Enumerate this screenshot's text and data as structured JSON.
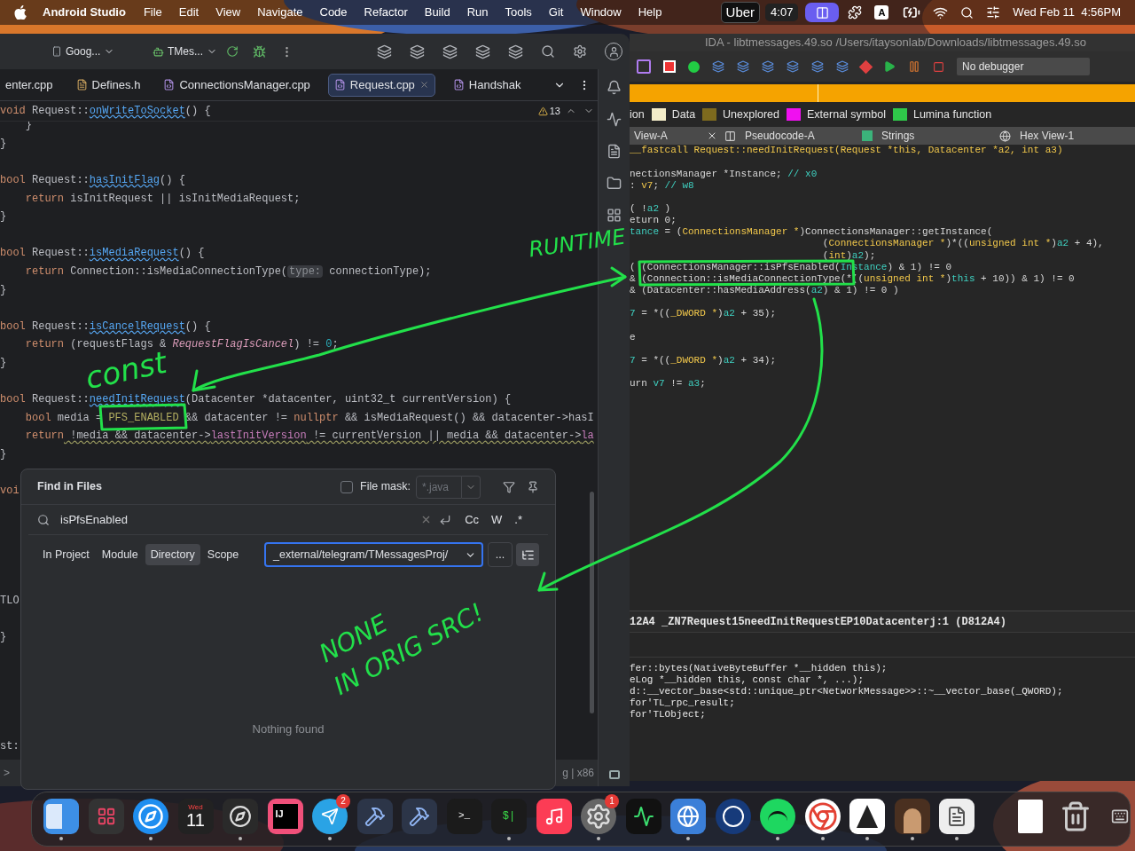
{
  "menu_bar": {
    "app": "Android Studio",
    "items": [
      "File",
      "Edit",
      "View",
      "Navigate",
      "Code",
      "Refactor",
      "Build",
      "Run",
      "Tools",
      "Git",
      "Window",
      "Help"
    ],
    "uber": "Uber",
    "timer": "4:07",
    "input_source": "A",
    "datetime": "Wed Feb 11  4:56PM"
  },
  "android_studio": {
    "device": "Goog...",
    "config": "TMes...",
    "tabs": [
      {
        "label": "enter.cpp",
        "kind": "plain",
        "selected": false
      },
      {
        "label": "Defines.h",
        "kind": "header",
        "selected": false
      },
      {
        "label": "ConnectionsManager.cpp",
        "kind": "cpp",
        "selected": false
      },
      {
        "label": "Request.cpp",
        "kind": "cpp",
        "selected": true
      },
      {
        "label": "Handshak",
        "kind": "cpp",
        "selected": false
      }
    ],
    "warning_count": "13",
    "sticky_line": [
      {
        "text": "void",
        "kind": "keyword"
      },
      {
        "text": " Request::",
        "kind": "plain"
      },
      {
        "text": "onWriteToSocket",
        "kind": "function"
      },
      {
        "text": "() {",
        "kind": "plain"
      }
    ],
    "code_lines": [
      {
        "kind": "code",
        "tokens": [
          {
            "text": "    }",
            "kind": "plain"
          }
        ]
      },
      {
        "kind": "code",
        "tokens": [
          {
            "text": "}",
            "kind": "plain"
          }
        ]
      },
      {
        "kind": "blank"
      },
      {
        "kind": "code",
        "tokens": [
          {
            "text": "bool",
            "kind": "keyword"
          },
          {
            "text": " Request::",
            "kind": "plain"
          },
          {
            "text": "hasInitFlag",
            "kind": "function"
          },
          {
            "text": "() {",
            "kind": "plain"
          }
        ]
      },
      {
        "kind": "code",
        "tokens": [
          {
            "text": "    return",
            "kind": "keyword"
          },
          {
            "text": " isInitRequest || isInitMediaRequest;",
            "kind": "plain"
          }
        ]
      },
      {
        "kind": "code",
        "tokens": [
          {
            "text": "}",
            "kind": "plain"
          }
        ]
      },
      {
        "kind": "blank"
      },
      {
        "kind": "code",
        "tokens": [
          {
            "text": "bool",
            "kind": "keyword"
          },
          {
            "text": " Request::",
            "kind": "plain"
          },
          {
            "text": "isMediaRequest",
            "kind": "function"
          },
          {
            "text": "() {",
            "kind": "plain"
          }
        ]
      },
      {
        "kind": "code",
        "tokens": [
          {
            "text": "    return",
            "kind": "keyword"
          },
          {
            "text": " Connection::isMediaConnectionType(",
            "kind": "plain"
          },
          {
            "text": "type:",
            "kind": "hint"
          },
          {
            "text": " connectionType);",
            "kind": "plain"
          }
        ]
      },
      {
        "kind": "code",
        "tokens": [
          {
            "text": "}",
            "kind": "plain"
          }
        ]
      },
      {
        "kind": "blank"
      },
      {
        "kind": "code",
        "tokens": [
          {
            "text": "bool",
            "kind": "keyword"
          },
          {
            "text": " Request::",
            "kind": "plain"
          },
          {
            "text": "isCancelRequest",
            "kind": "function"
          },
          {
            "text": "() {",
            "kind": "plain"
          }
        ]
      },
      {
        "kind": "code",
        "tokens": [
          {
            "text": "    return",
            "kind": "keyword"
          },
          {
            "text": " (requestFlags & ",
            "kind": "plain"
          },
          {
            "text": "RequestFlagIsCancel",
            "kind": "constant"
          },
          {
            "text": ") != ",
            "kind": "plain"
          },
          {
            "text": "0",
            "kind": "number"
          },
          {
            "text": ";",
            "kind": "plain"
          }
        ]
      },
      {
        "kind": "code",
        "tokens": [
          {
            "text": "}",
            "kind": "plain"
          }
        ]
      },
      {
        "kind": "blank"
      },
      {
        "kind": "code",
        "tokens": [
          {
            "text": "bool",
            "kind": "keyword"
          },
          {
            "text": " Request::",
            "kind": "plain"
          },
          {
            "text": "needInitRequest",
            "kind": "function"
          },
          {
            "text": "(Datacenter *datacenter, uint32_t currentVersion) {",
            "kind": "plain"
          }
        ]
      },
      {
        "kind": "code",
        "tokens": [
          {
            "text": "    bool",
            "kind": "keyword"
          },
          {
            "text": " media = ",
            "kind": "plain"
          },
          {
            "text": "PFS_ENABLED",
            "kind": "macro"
          },
          {
            "text": " && datacenter != ",
            "kind": "plain"
          },
          {
            "text": "nullptr",
            "kind": "keyword"
          },
          {
            "text": " && isMediaRequest() && datacenter->hasI",
            "kind": "plain"
          }
        ]
      },
      {
        "kind": "code",
        "tokens": [
          {
            "text": "    return",
            "kind": "keyword"
          },
          {
            "text": " !media && datacenter->",
            "kind": "warn"
          },
          {
            "text": "lastInitVersion",
            "kind": "field"
          },
          {
            "text": " != currentVersion || media && datacenter->",
            "kind": "warn"
          },
          {
            "text": "la",
            "kind": "field"
          }
        ]
      },
      {
        "kind": "code",
        "tokens": [
          {
            "text": "}",
            "kind": "plain"
          }
        ]
      },
      {
        "kind": "blank"
      },
      {
        "kind": "code",
        "tokens": [
          {
            "text": "voi",
            "kind": "keyword"
          }
        ]
      },
      {
        "kind": "blank"
      },
      {
        "kind": "blank"
      },
      {
        "kind": "blank"
      },
      {
        "kind": "blank"
      },
      {
        "kind": "blank"
      },
      {
        "kind": "code",
        "tokens": [
          {
            "text": "TLO",
            "kind": "plain"
          }
        ]
      },
      {
        "kind": "blank"
      },
      {
        "kind": "code",
        "tokens": [
          {
            "text": "}",
            "kind": "plain"
          }
        ]
      },
      {
        "kind": "blank"
      },
      {
        "kind": "blank"
      },
      {
        "kind": "blank"
      },
      {
        "kind": "blank"
      },
      {
        "kind": "blank"
      },
      {
        "kind": "code",
        "tokens": [
          {
            "text": "st:",
            "kind": "plain"
          }
        ]
      }
    ],
    "status_left": ">",
    "status_right": "g | x86"
  },
  "find_in_files": {
    "title": "Find in Files",
    "file_mask": {
      "label": "File mask:",
      "checked": false,
      "placeholder": "*.java"
    },
    "query": "isPfsEnabled",
    "options": [
      {
        "label": "Cc",
        "selected": false
      },
      {
        "label": "W",
        "selected": false
      },
      {
        "label": ".*",
        "selected": false
      }
    ],
    "scopes": [
      {
        "label": "In Project",
        "selected": false
      },
      {
        "label": "Module",
        "selected": false
      },
      {
        "label": "Directory",
        "selected": true
      },
      {
        "label": "Scope",
        "selected": false
      }
    ],
    "directory": "_external/telegram/TMessagesProj/",
    "browse": "...",
    "result": "Nothing found"
  },
  "ida": {
    "title": "IDA - libtmessages.49.so /Users/itaysonlab/Downloads/libtmessages.49.so",
    "debugger": "No debugger",
    "legend": [
      {
        "label": "ion"
      },
      {
        "label": "Data",
        "color": "#f3ecc8"
      },
      {
        "label": "Unexplored",
        "color": "#7d6a1e"
      },
      {
        "label": "External symbol",
        "color": "#f010f0"
      },
      {
        "label": "Lumina function",
        "color": "#2fc84a"
      }
    ],
    "tabs": [
      {
        "label": "View-A",
        "kind": "view",
        "selected": false
      },
      {
        "label": "Pseudocode-A",
        "kind": "pseudocode",
        "selected": false
      },
      {
        "label": "Strings",
        "kind": "strings",
        "selected": false
      },
      {
        "label": "Hex View-1",
        "kind": "hex",
        "selected": false
      }
    ],
    "pseudocode": [
      {
        "kind": "code",
        "tokens": [
          {
            "text": "__fastcall Request::needInitRequest(Request *this, Datacenter *a2, int a3)",
            "kind": "type"
          }
        ]
      },
      {
        "kind": "blank"
      },
      {
        "kind": "code",
        "tokens": [
          {
            "text": "nectionsManager *Instance; ",
            "kind": "plain"
          },
          {
            "text": "// x0",
            "kind": "comment"
          }
        ]
      },
      {
        "kind": "code",
        "tokens": [
          {
            "text": ": ",
            "kind": "plain"
          },
          {
            "text": "v7",
            "kind": "type"
          },
          {
            "text": "; ",
            "kind": "plain"
          },
          {
            "text": "// w8",
            "kind": "comment"
          }
        ]
      },
      {
        "kind": "blank"
      },
      {
        "kind": "code",
        "tokens": [
          {
            "text": "( !",
            "kind": "plain"
          },
          {
            "text": "a2",
            "kind": "var"
          },
          {
            "text": " )",
            "kind": "plain"
          }
        ]
      },
      {
        "kind": "code",
        "tokens": [
          {
            "text": "eturn 0;",
            "kind": "plain"
          }
        ]
      },
      {
        "kind": "code",
        "tokens": [
          {
            "text": "tance",
            "kind": "var"
          },
          {
            "text": " = (",
            "kind": "plain"
          },
          {
            "text": "ConnectionsManager *",
            "kind": "type"
          },
          {
            "text": ")ConnectionsManager::getInstance(",
            "kind": "plain"
          }
        ]
      },
      {
        "kind": "code",
        "tokens": [
          {
            "text": "                                 (",
            "kind": "plain"
          },
          {
            "text": "ConnectionsManager *",
            "kind": "type"
          },
          {
            "text": ")*((",
            "kind": "plain"
          },
          {
            "text": "unsigned int *",
            "kind": "type"
          },
          {
            "text": ")",
            "kind": "plain"
          },
          {
            "text": "a2",
            "kind": "var"
          },
          {
            "text": " + 4),",
            "kind": "plain"
          }
        ]
      },
      {
        "kind": "code",
        "tokens": [
          {
            "text": "                                 (",
            "kind": "plain"
          },
          {
            "text": "int",
            "kind": "type"
          },
          {
            "text": ")",
            "kind": "plain"
          },
          {
            "text": "a2",
            "kind": "var"
          },
          {
            "text": ");",
            "kind": "plain"
          }
        ]
      },
      {
        "kind": "code",
        "tokens": [
          {
            "text": "( (ConnectionsManager::isPfsEnabled(",
            "kind": "plain"
          },
          {
            "text": "Instance",
            "kind": "var"
          },
          {
            "text": ") & 1) != 0",
            "kind": "plain"
          }
        ]
      },
      {
        "kind": "code",
        "tokens": [
          {
            "text": "& (Connection::isMediaConnectionType(*((",
            "kind": "plain"
          },
          {
            "text": "unsigned int *",
            "kind": "type"
          },
          {
            "text": ")",
            "kind": "plain"
          },
          {
            "text": "this",
            "kind": "var"
          },
          {
            "text": " + 10)) & 1) != 0",
            "kind": "plain"
          }
        ]
      },
      {
        "kind": "code",
        "tokens": [
          {
            "text": "& (Datacenter::hasMediaAddress(",
            "kind": "plain"
          },
          {
            "text": "a2",
            "kind": "var"
          },
          {
            "text": ") & 1) != 0 )",
            "kind": "plain"
          }
        ]
      },
      {
        "kind": "blank"
      },
      {
        "kind": "code",
        "tokens": [
          {
            "text": "7",
            "kind": "var"
          },
          {
            "text": " = *((",
            "kind": "plain"
          },
          {
            "text": "_DWORD *",
            "kind": "type"
          },
          {
            "text": ")",
            "kind": "plain"
          },
          {
            "text": "a2",
            "kind": "var"
          },
          {
            "text": " + 35);",
            "kind": "plain"
          }
        ]
      },
      {
        "kind": "blank"
      },
      {
        "kind": "code",
        "tokens": [
          {
            "text": "e",
            "kind": "plain"
          }
        ]
      },
      {
        "kind": "blank"
      },
      {
        "kind": "code",
        "tokens": [
          {
            "text": "7",
            "kind": "var"
          },
          {
            "text": " = *((",
            "kind": "plain"
          },
          {
            "text": "_DWORD *",
            "kind": "type"
          },
          {
            "text": ")",
            "kind": "plain"
          },
          {
            "text": "a2",
            "kind": "var"
          },
          {
            "text": " + 34);",
            "kind": "plain"
          }
        ]
      },
      {
        "kind": "blank"
      },
      {
        "kind": "code",
        "tokens": [
          {
            "text": "urn ",
            "kind": "plain"
          },
          {
            "text": "v7",
            "kind": "var"
          },
          {
            "text": " != ",
            "kind": "plain"
          },
          {
            "text": "a3",
            "kind": "var"
          },
          {
            "text": ";",
            "kind": "plain"
          }
        ]
      }
    ],
    "location": "12A4 _ZN7Request15needInitRequestEP10Datacenterj:1 (D812A4)",
    "output": [
      "fer::bytes(NativeByteBuffer *__hidden this);",
      "eLog *__hidden this, const char *, ...);",
      "d::__vector_base<std::unique_ptr<NetworkMessage>>::~__vector_base(_QWORD);",
      "for'TL_rpc_result;",
      "for'TLObject;"
    ]
  },
  "annotations": [
    {
      "kind": "runtime",
      "text": "RUNTIME"
    },
    {
      "kind": "const",
      "text": "const"
    },
    {
      "kind": "none",
      "text": "NONE"
    },
    {
      "kind": "orig",
      "text": "IN ORIG SRC!"
    }
  ],
  "dock": [
    {
      "kind": "finder",
      "running": true
    },
    {
      "kind": "launchpad",
      "running": false
    },
    {
      "kind": "safari",
      "running": true
    },
    {
      "kind": "calendar",
      "month": "Wed",
      "day": "11",
      "running": false
    },
    {
      "kind": "compass",
      "running": true
    },
    {
      "kind": "intellij",
      "label": "IJ",
      "running": false
    },
    {
      "kind": "telegram",
      "badge": "2",
      "running": true
    },
    {
      "kind": "hammer",
      "running": false
    },
    {
      "kind": "hammer",
      "running": false
    },
    {
      "kind": "terminal",
      "label": ">_",
      "running": false
    },
    {
      "kind": "iterm",
      "label": "$|",
      "running": true
    },
    {
      "kind": "music",
      "running": false
    },
    {
      "kind": "settings",
      "badge": "1",
      "running": true
    },
    {
      "kind": "activity",
      "running": false
    },
    {
      "kind": "globe",
      "running": true
    },
    {
      "kind": "wapp",
      "running": false
    },
    {
      "kind": "spotify",
      "running": true
    },
    {
      "kind": "chrome",
      "running": true
    },
    {
      "kind": "java",
      "running": true
    },
    {
      "kind": "portrait",
      "running": true
    },
    {
      "kind": "notes",
      "running": true
    },
    {
      "kind": "separator"
    },
    {
      "kind": "document",
      "running": false
    },
    {
      "kind": "trash",
      "running": false
    },
    {
      "kind": "keyboard",
      "running": false
    }
  ]
}
